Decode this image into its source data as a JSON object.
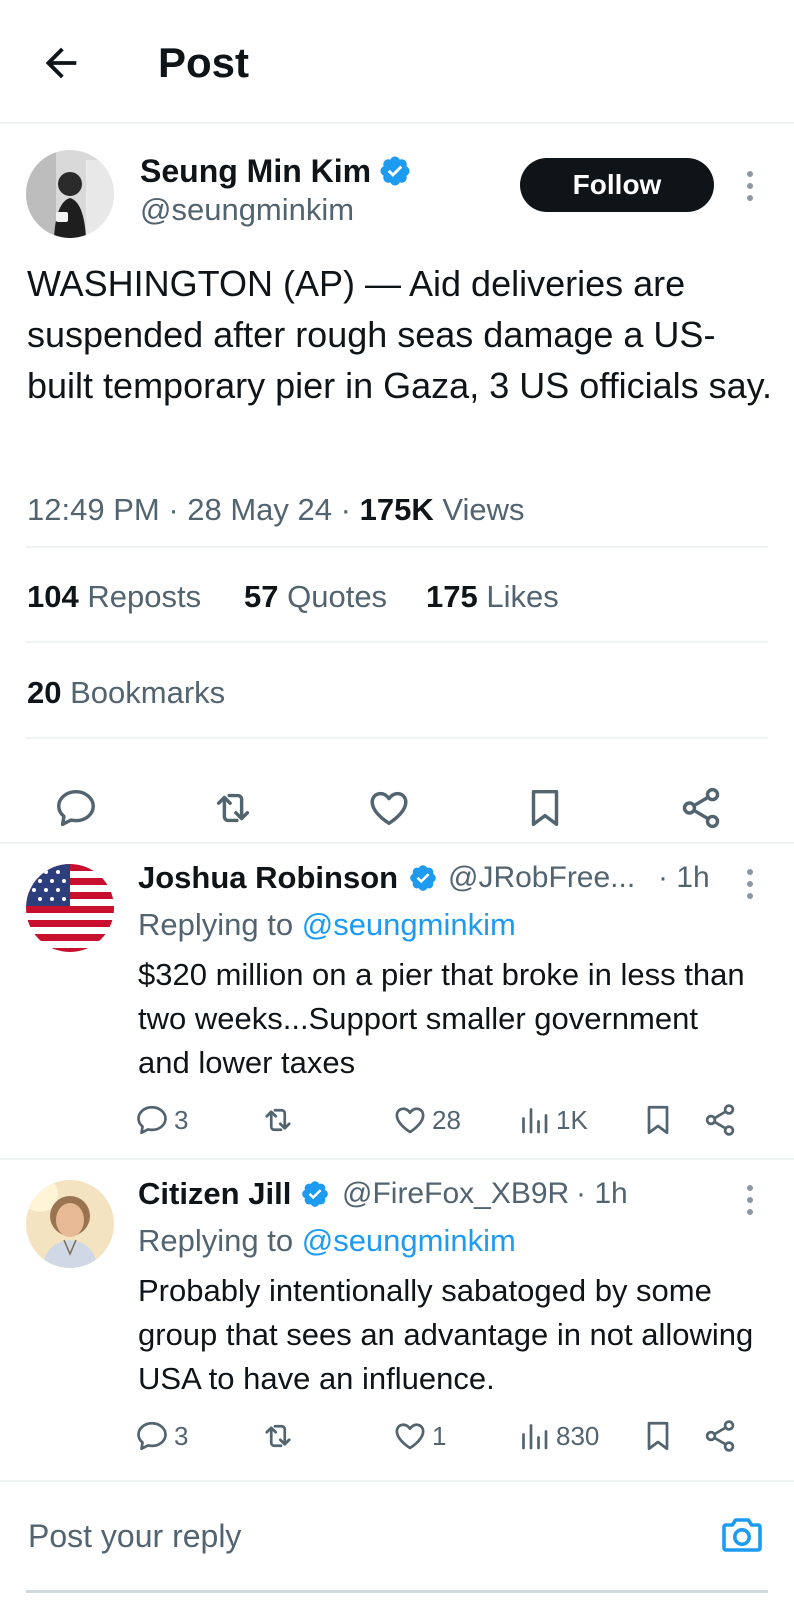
{
  "header": {
    "title": "Post",
    "back_icon": "arrow-left-icon"
  },
  "post": {
    "author_name": "Seung Min Kim",
    "author_handle": "@seungminkim",
    "verified": true,
    "follow_label": "Follow",
    "text": "WASHINGTON (AP) — Aid deliveries are suspended after rough seas damage a US-built temporary pier in Gaza, 3 US officials say.",
    "time": "12:49 PM",
    "date": "28 May 24",
    "views_count": "175K",
    "views_label": "Views",
    "reposts_count": "104",
    "reposts_label": "Reposts",
    "quotes_count": "57",
    "quotes_label": "Quotes",
    "likes_count": "175",
    "likes_label": "Likes",
    "bookmarks_count": "20",
    "bookmarks_label": "Bookmarks",
    "actions": [
      "reply-icon",
      "repost-icon",
      "like-icon",
      "bookmark-icon",
      "share-icon"
    ]
  },
  "replies": [
    {
      "name": "Joshua Robinson",
      "handle": "@JRobFree...",
      "time": "· 1h",
      "replying_prefix": "Replying to",
      "replying_to": "@seungminkim",
      "text": "$320 million on a pier that broke in less than two weeks...Support smaller government and lower taxes",
      "replies": "3",
      "reposts": "",
      "likes": "28",
      "views": "1K"
    },
    {
      "name": "Citizen Jill",
      "handle": "@FireFox_XB9R",
      "time": "· 1h",
      "replying_prefix": "Replying to",
      "replying_to": "@seungminkim",
      "text": "Probably intentionally sabatoged by some group that sees an advantage in not allowing USA to have an influence.",
      "replies": "3",
      "reposts": "",
      "likes": "1",
      "views": "830"
    }
  ],
  "reply_box": {
    "placeholder": "Post your reply",
    "camera_icon": "camera-icon"
  },
  "colors": {
    "accent": "#1d9bf0",
    "text": "#0f1419",
    "muted": "#536471",
    "divider": "#eff3f4"
  }
}
